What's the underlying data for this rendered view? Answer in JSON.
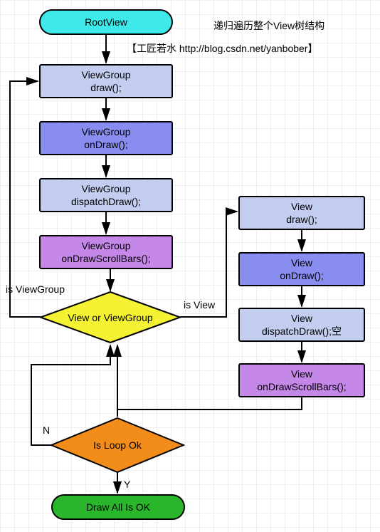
{
  "title_main": "递归遍历整个View树结构",
  "title_sub": "【工匠若水 http://blog.csdn.net/yanbober】",
  "root": "RootView",
  "vg_draw": "ViewGroup\ndraw();",
  "vg_ondraw": "ViewGroup\nonDraw();",
  "vg_dispatch": "ViewGroup\ndispatchDraw();",
  "vg_scroll": "ViewGroup\nonDrawScrollBars();",
  "decision1": "View or ViewGroup",
  "branch_left": "is ViewGroup",
  "branch_right": "is View",
  "v_draw": "View\ndraw();",
  "v_ondraw": "View\nonDraw();",
  "v_dispatch": "View\ndispatchDraw();空",
  "v_scroll": "View\nonDrawScrollBars();",
  "decision2": "Is Loop Ok",
  "result_n": "N",
  "result_y": "Y",
  "final": "Draw All Is OK"
}
